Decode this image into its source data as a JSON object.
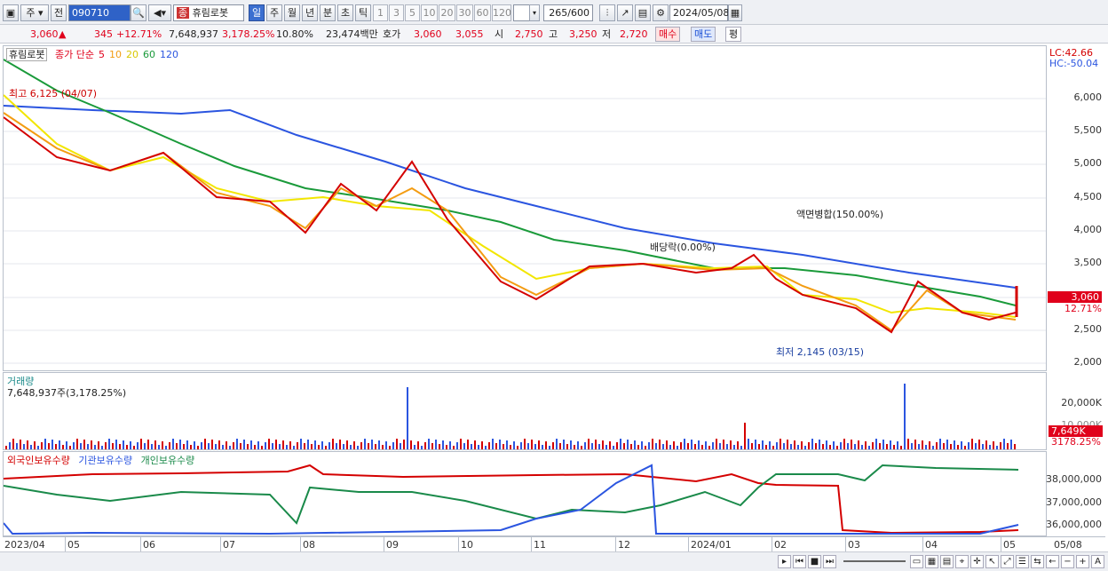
{
  "toolbar": {
    "period_toggle": "주",
    "prev_label": "전",
    "code": "090710",
    "stock_name": "휴림로봇",
    "stock_tag": "종",
    "tabs": [
      "일",
      "주",
      "월",
      "년",
      "분",
      "초",
      "틱"
    ],
    "intervals": [
      "1",
      "3",
      "5",
      "10",
      "20",
      "30",
      "60",
      "120"
    ],
    "count": "265",
    "count_total": "/600",
    "date": "2024/05/08"
  },
  "quote": {
    "price": "3,060",
    "arrow": "▲",
    "change": "345",
    "change_pct": "+12.71%",
    "volume": "7,648,937",
    "volume_pct": "3,178.25%",
    "turnover": "10.80%",
    "amount": "23,474백만",
    "bid_label": "호가",
    "bid1": "3,060",
    "bid2": "3,055",
    "open_label": "시",
    "open": "2,750",
    "high_label": "고",
    "high": "3,250",
    "low_label": "저",
    "low": "2,720",
    "buy_label": "매수",
    "sell_label": "매도",
    "avg_label": "평"
  },
  "price_pane": {
    "name": "휴림로봇",
    "ma_title": "종가 단순",
    "ma_periods": [
      "5",
      "10",
      "20",
      "60",
      "120"
    ],
    "ma_colors": [
      "#d40000",
      "#f39c12",
      "#f2e600",
      "#1a9a3a",
      "#2b55e0"
    ],
    "lc": "LC:42.66",
    "hc": "HC:-50.04",
    "high_note": "최고 6,125 (04/07)",
    "low_note": "최저 2,145 (03/15)",
    "event1": "배당락(0.00%)",
    "event2": "액면병합(150.00%)",
    "last_price": "3,060",
    "last_pct": "12.71%",
    "y_ticks": [
      "6,000",
      "5,500",
      "5,000",
      "4,500",
      "4,000",
      "3,500",
      "3,000",
      "2,500",
      "2,000"
    ]
  },
  "volume_pane": {
    "title": "거래량",
    "subtitle": "7,648,937주(3,178.25%)",
    "y_ticks": [
      "20,000K",
      "10,000K"
    ],
    "last_value": "7,649K",
    "last_pct": "3178.25%"
  },
  "ownership_pane": {
    "series": [
      "외국인보유수량",
      "기관보유수량",
      "개인보유수량"
    ],
    "colors": [
      "#d40000",
      "#2b55e0",
      "#1a8a4a"
    ],
    "y_ticks": [
      "38,000,000",
      "37,000,000",
      "36,000,000"
    ]
  },
  "date_axis": [
    "2023/04",
    "05",
    "06",
    "07",
    "08",
    "09",
    "10",
    "11",
    "12",
    "2024/01",
    "02",
    "03",
    "04",
    "05",
    "05/08"
  ]
}
